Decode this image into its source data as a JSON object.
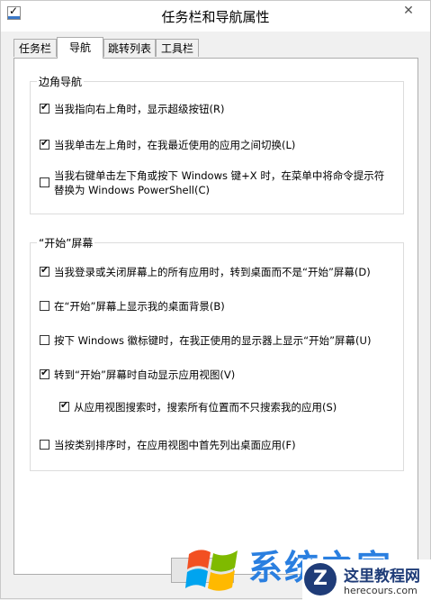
{
  "window": {
    "title": "任务栏和导航属性",
    "close_glyph": "✕"
  },
  "tabs": [
    {
      "label": "任务栏",
      "active": false
    },
    {
      "label": "导航",
      "active": true
    },
    {
      "label": "跳转列表",
      "active": false
    },
    {
      "label": "工具栏",
      "active": false
    }
  ],
  "corner_nav": {
    "title": "边角导航",
    "items": [
      {
        "label": "当我指向右上角时，显示超级按钮(R)",
        "checked": true
      },
      {
        "label": "当我单击左上角时，在我最近使用的应用之间切换(L)",
        "checked": true
      },
      {
        "label": "当我右键单击左下角或按下 Windows 键+X 时，在菜单中将命令提示符",
        "label2": "替换为 Windows PowerShell(C)",
        "checked": false
      }
    ]
  },
  "start_screen": {
    "title": "“开始”屏幕",
    "items": [
      {
        "label": "当我登录或关闭屏幕上的所有应用时，转到桌面而不是“开始”屏幕(D)",
        "checked": true
      },
      {
        "label": "在“开始”屏幕上显示我的桌面背景(B)",
        "checked": false
      },
      {
        "label": "按下 Windows 徽标键时，在我正使用的显示器上显示“开始”屏幕(U)",
        "checked": false
      },
      {
        "label": "转到“开始”屏幕时自动显示应用视图(V)",
        "checked": true
      },
      {
        "label": "从应用视图搜索时，搜索所有位置而不只搜索我的应用(S)",
        "checked": true
      },
      {
        "label": "当按类别排序时，在应用视图中首先列出桌面应用(F)",
        "checked": false
      }
    ]
  },
  "watermark": {
    "text": "系统之家",
    "badge_letter": "Z",
    "badge_title": "这里教程网",
    "badge_url": "herecours.com"
  },
  "colors": {
    "accent": "#2a7fe0",
    "badge": "#1f3c78"
  }
}
